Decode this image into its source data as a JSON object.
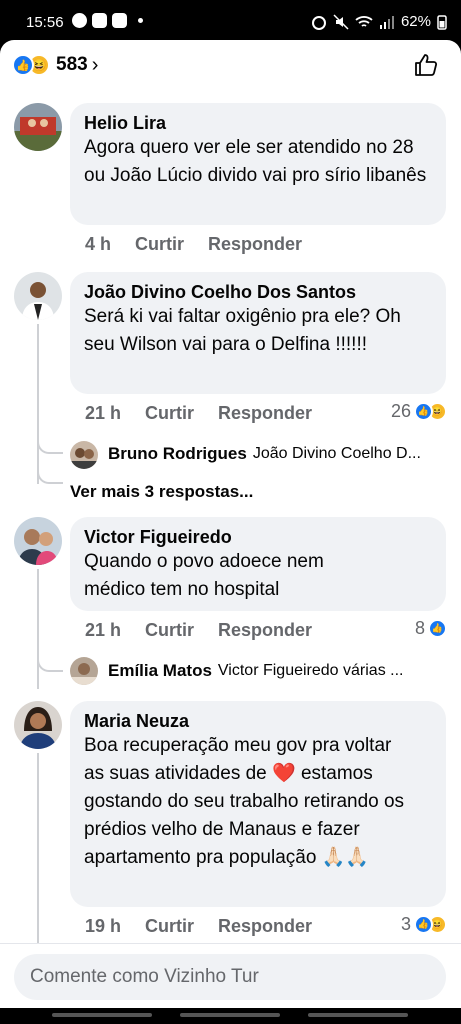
{
  "status": {
    "time": "15:56",
    "battery": "62%"
  },
  "reactions": {
    "count": "583",
    "chevron": "›"
  },
  "comments": [
    {
      "author": "Helio Lira",
      "text": "Agora quero ver ele ser atendido no 28 ou João Lúcio divido vai pro sírio libanês",
      "time": "4 h",
      "like": "Curtir",
      "reply": "Responder",
      "reaction_count": ""
    },
    {
      "author": "João Divino Coelho Dos Santos",
      "text": "Será  ki vai faltar oxigênio pra ele? Oh seu Wilson vai para o Delfina !!!!!!",
      "time": "21 h",
      "like": "Curtir",
      "reply": "Responder",
      "reaction_count": "26",
      "replies": [
        {
          "author": "Bruno Rodrigues",
          "text": "João Divino Coelho D..."
        }
      ],
      "more_replies": "Ver mais 3 respostas..."
    },
    {
      "author": "Victor Figueiredo",
      "text": "Quando o povo adoece nem médico tem no hospital",
      "time": "21 h",
      "like": "Curtir",
      "reply": "Responder",
      "reaction_count": "8",
      "replies": [
        {
          "author": "Emília Matos",
          "text": "Victor Figueiredo várias ..."
        }
      ]
    },
    {
      "author": "Maria Neuza",
      "text": "Boa recuperação meu gov  pra voltar as suas atividades de ❤️ estamos gostando do seu trabalho retirando os prédios velho de Manaus e fazer apartamento pra população 🙏🏻🙏🏻",
      "time": "19 h",
      "like": "Curtir",
      "reply": "Responder",
      "reaction_count": "3"
    }
  ],
  "composer": {
    "placeholder": "Comente como Vizinho Tur"
  },
  "colors": {
    "accent": "#1877f2",
    "bubble": "#f0f2f5",
    "meta": "#65676b"
  }
}
